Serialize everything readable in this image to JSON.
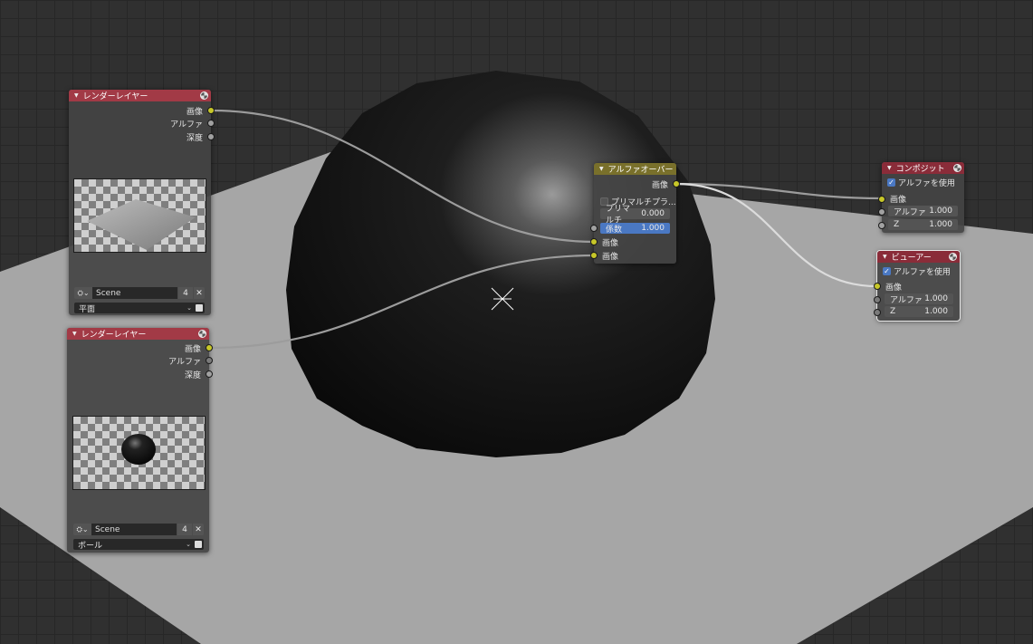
{
  "render_layers_top": {
    "title": "レンダーレイヤー",
    "outputs": [
      "画像",
      "アルファ",
      "深度"
    ],
    "scene": "Scene",
    "scene_users": "4",
    "close": "✕",
    "layer": "平面"
  },
  "render_layers_bottom": {
    "title": "レンダーレイヤー",
    "outputs": [
      "画像",
      "アルファ",
      "深度"
    ],
    "scene": "Scene",
    "scene_users": "4",
    "close": "✕",
    "layer": "ボール"
  },
  "alpha_over": {
    "title": "アルファオーバー",
    "output": "画像",
    "convert_premult_label": "プリマルチプラ...",
    "premult_label": "プリマルチ",
    "premult_value": "0.000",
    "fac_label": "係数",
    "fac_value": "1.000",
    "inputs": [
      "画像",
      "画像"
    ]
  },
  "composite": {
    "title": "コンポジット",
    "use_alpha_label": "アルファを使用",
    "use_alpha": true,
    "image_label": "画像",
    "alpha_label": "アルファ",
    "alpha_value": "1.000",
    "z_label": "Z",
    "z_value": "1.000"
  },
  "viewer": {
    "title": "ビューアー",
    "use_alpha_label": "アルファを使用",
    "use_alpha": true,
    "image_label": "画像",
    "alpha_label": "アルファ",
    "alpha_value": "1.000",
    "z_label": "Z",
    "z_value": "1.000"
  },
  "colors": {
    "render_layer_header": "#a23a46",
    "alpha_over_header": "#79702b",
    "composite_header": "#8a2c39",
    "socket_color": "#c7c729",
    "link_color": "#a0a0a0",
    "checkbox_on": "#4a78c3"
  }
}
